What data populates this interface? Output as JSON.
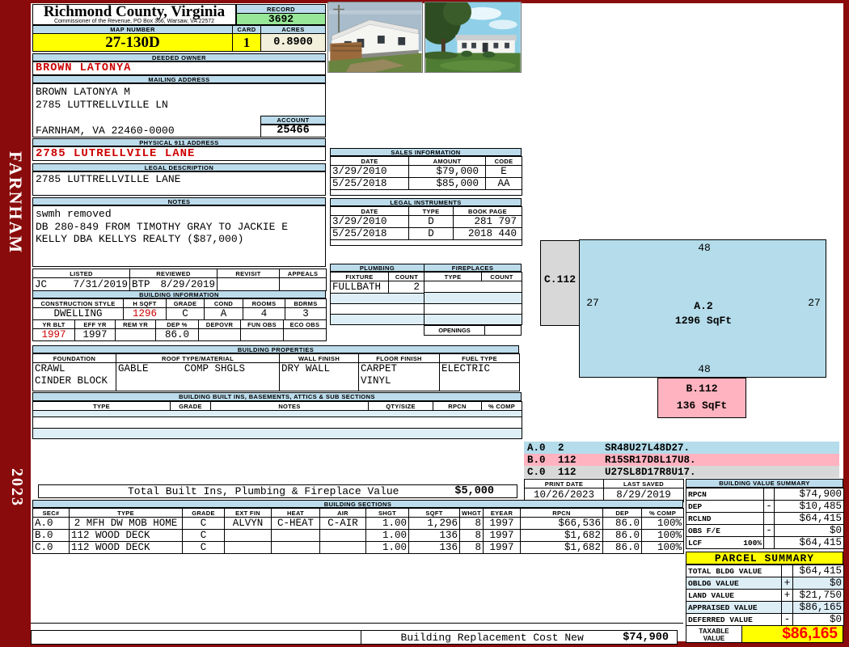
{
  "colors": {
    "frame_maroon": "#8a0b0b",
    "band_blue": "#bcdcec",
    "highlight_yellow": "#ffff00",
    "record_green": "#98e698",
    "acres_cream": "#f2efda",
    "stripe_blue": "#ddeef6",
    "sketch_blue": "#b4dcea",
    "sketch_pink": "#ffb3c0",
    "sketch_gray": "#d8d8d8",
    "value_red": "#cc0000",
    "taxable_red": "#ff0000"
  },
  "sidebar": {
    "district": "FARNHAM",
    "year": "2023"
  },
  "header": {
    "county": "Richmond County, Virginia",
    "commissioner": "Commissioner of the Revenue, PO Box 366, Warsaw, VA 22572",
    "record_label": "RECORD",
    "record_value": "3692",
    "map_label": "MAP NUMBER",
    "map_value": "27-130D",
    "card_label": "CARD",
    "card_value": "1",
    "acres_label": "ACRES",
    "acres_value": "0.8900"
  },
  "owner": {
    "label": "DEEDED OWNER",
    "name": "BROWN LATONYA"
  },
  "mailing": {
    "label": "MAILING ADDRESS",
    "line1": "BROWN LATONYA M",
    "line2": "2785 LUTTRELLVILLE LN",
    "line3": "FARNHAM, VA 22460-0000",
    "account_label": "ACCOUNT",
    "account_value": "25466"
  },
  "physical": {
    "label": "PHYSICAL 911 ADDRESS",
    "value": "2785 LUTRELLVILE LANE"
  },
  "legal": {
    "label": "LEGAL DESCRIPTION",
    "value": "2785 LUTTRELLVILLE LANE"
  },
  "notes": {
    "label": "NOTES",
    "line1": "swmh removed",
    "line2": "DB 280-849 FROM TIMOTHY GRAY TO JACKIE E",
    "line3": "KELLY DBA KELLYS REALTY ($87,000)"
  },
  "review": {
    "listed_label": "LISTED",
    "reviewed_label": "REVIEWED",
    "revisit_label": "REVISIT",
    "appeals_label": "APPEALS",
    "listed_code": "JC",
    "listed_date": "7/31/2019",
    "reviewed_code": "BTP",
    "reviewed_date": "8/29/2019",
    "revisit_value": "",
    "appeals_value": ""
  },
  "building_info": {
    "title": "BUILDING INFORMATION",
    "style_label": "CONSTRUCTION STYLE",
    "hsqft_label": "H SQFT",
    "grade_label": "GRADE",
    "cond_label": "COND",
    "rooms_label": "ROOMS",
    "bdrms_label": "BDRMS",
    "style": "DWELLING",
    "hsqft": "1296",
    "grade": "C",
    "cond": "A",
    "rooms": "4",
    "bdrms": "3",
    "yrblt_label": "YR BLT",
    "effyr_label": "EFF YR",
    "remyr_label": "REM YR",
    "dep_label": "DEP %",
    "depovr_label": "DEPOVR",
    "funobs_label": "FUN OBS",
    "ecoobs_label": "ECO OBS",
    "yrblt": "1997",
    "effyr": "1997",
    "remyr": "",
    "dep": "86.0",
    "depovr": "",
    "funobs": "",
    "ecoobs": ""
  },
  "building_props": {
    "title": "BUILDING PROPERTIES",
    "foundation_label": "FOUNDATION",
    "roof_label": "ROOF TYPE/MATERIAL",
    "wall_label": "WALL FINISH",
    "floor_label": "FLOOR FINISH",
    "fuel_label": "FUEL TYPE",
    "foundation1": "CRAWL",
    "foundation2": "CINDER BLOCK",
    "roof_type": "GABLE",
    "roof_material": "COMP SHGLS",
    "wall": "DRY WALL",
    "floor1": "CARPET",
    "floor2": "VINYL",
    "fuel": "ELECTRIC"
  },
  "built_ins": {
    "title": "BUILDING BUILT INS, BASEMENTS, ATTICS & SUB SECTIONS",
    "col_type": "TYPE",
    "col_grade": "GRADE",
    "col_notes": "NOTES",
    "col_qty": "QTY/SIZE",
    "col_rpcn": "RPCN",
    "col_comp": "% COMP"
  },
  "sales": {
    "title": "SALES INFORMATION",
    "col_date": "DATE",
    "col_amount": "AMOUNT",
    "col_code": "CODE",
    "rows": [
      {
        "date": "3/29/2010",
        "amount": "$79,000",
        "code": "E"
      },
      {
        "date": "5/25/2018",
        "amount": "$85,000",
        "code": "AA"
      }
    ]
  },
  "instruments": {
    "title": "LEGAL INSTRUMENTS",
    "col_date": "DATE",
    "col_type": "TYPE",
    "col_book": "BOOK PAGE",
    "rows": [
      {
        "date": "3/29/2010",
        "type": "D",
        "book": "281 797"
      },
      {
        "date": "5/25/2018",
        "type": "D",
        "book": "2018 440"
      }
    ]
  },
  "plumbing": {
    "title": "PLUMBING",
    "col_fixture": "FIXTURE",
    "col_count": "COUNT",
    "rows": [
      {
        "fixture": "FULLBATH",
        "count": "2"
      }
    ]
  },
  "fireplaces": {
    "title": "FIREPLACES",
    "col_type": "TYPE",
    "col_count": "COUNT",
    "openings_label": "OPENINGS",
    "openings_value": ""
  },
  "sketch": {
    "a_label": "A.2",
    "a_sqft": "1296 SqFt",
    "a_top": "48",
    "a_bottom": "48",
    "a_left": "27",
    "a_right": "27",
    "b_label": "B.112",
    "b_sqft": "136 SqFt",
    "c_label": "C.112",
    "legend": [
      {
        "sec": "A.0",
        "qty": "2",
        "path": "SR48U27L48D27."
      },
      {
        "sec": "B.0",
        "qty": "112",
        "path": "R15SR17D8L17U8."
      },
      {
        "sec": "C.0",
        "qty": "112",
        "path": "U27SL8D17R8U17."
      }
    ]
  },
  "print_info": {
    "print_label": "PRINT DATE",
    "print_date": "10/26/2023",
    "saved_label": "LAST SAVED",
    "last_saved": "8/29/2019"
  },
  "bvs": {
    "title": "BUILDING VALUE SUMMARY",
    "rows": [
      {
        "label": "RPCN",
        "op": "",
        "value": "$74,900"
      },
      {
        "label": "DEP",
        "op": "-",
        "value": "$10,485"
      },
      {
        "label": "RCLND",
        "op": "",
        "value": "$64,415"
      },
      {
        "label": "OBS F/E",
        "op": "-",
        "value": "$0"
      },
      {
        "label": "LCF",
        "pct": "100%",
        "op": "",
        "value": "$64,415"
      }
    ]
  },
  "totals": {
    "built_ins_label": "Total Built Ins, Plumbing & Fireplace Value",
    "built_ins_value": "$5,000"
  },
  "sections": {
    "title": "BUILDING SECTIONS",
    "columns": [
      "SEC#",
      "TYPE",
      "GRADE",
      "EXT FIN",
      "HEAT",
      "AIR",
      "SHGT",
      "SQFT",
      "WHGT",
      "EYEAR",
      "RPCN",
      "DEP",
      "% COMP"
    ],
    "rows": [
      [
        "A.0",
        "2 MFH DW MOB HOME",
        "C",
        "ALVYN",
        "C-HEAT",
        "C-AIR",
        "1.00",
        "1,296",
        "8",
        "1997",
        "$66,536",
        "86.0",
        "100%"
      ],
      [
        "B.0",
        "112 WOOD DECK",
        "C",
        "",
        "",
        "",
        "1.00",
        "136",
        "8",
        "1997",
        "$1,682",
        "86.0",
        "100%"
      ],
      [
        "C.0",
        "112 WOOD DECK",
        "C",
        "",
        "",
        "",
        "1.00",
        "136",
        "8",
        "1997",
        "$1,682",
        "86.0",
        "100%"
      ]
    ]
  },
  "parcel": {
    "title": "PARCEL SUMMARY",
    "rows": [
      {
        "label": "TOTAL BLDG VALUE",
        "op": "",
        "value": "$64,415"
      },
      {
        "label": "OBLDG VALUE",
        "op": "+",
        "value": "$0"
      },
      {
        "label": "LAND VALUE",
        "op": "+",
        "value": "$21,750"
      },
      {
        "label": "APPRAISED VALUE",
        "op": "",
        "value": "$86,165"
      },
      {
        "label": "DEFERRED VALUE",
        "op": "-",
        "value": "$0"
      }
    ],
    "taxable_label1": "TAXABLE",
    "taxable_label2": "VALUE",
    "taxable_value": "$86,165"
  },
  "replacement": {
    "label": "Building Replacement Cost New",
    "value": "$74,900"
  }
}
